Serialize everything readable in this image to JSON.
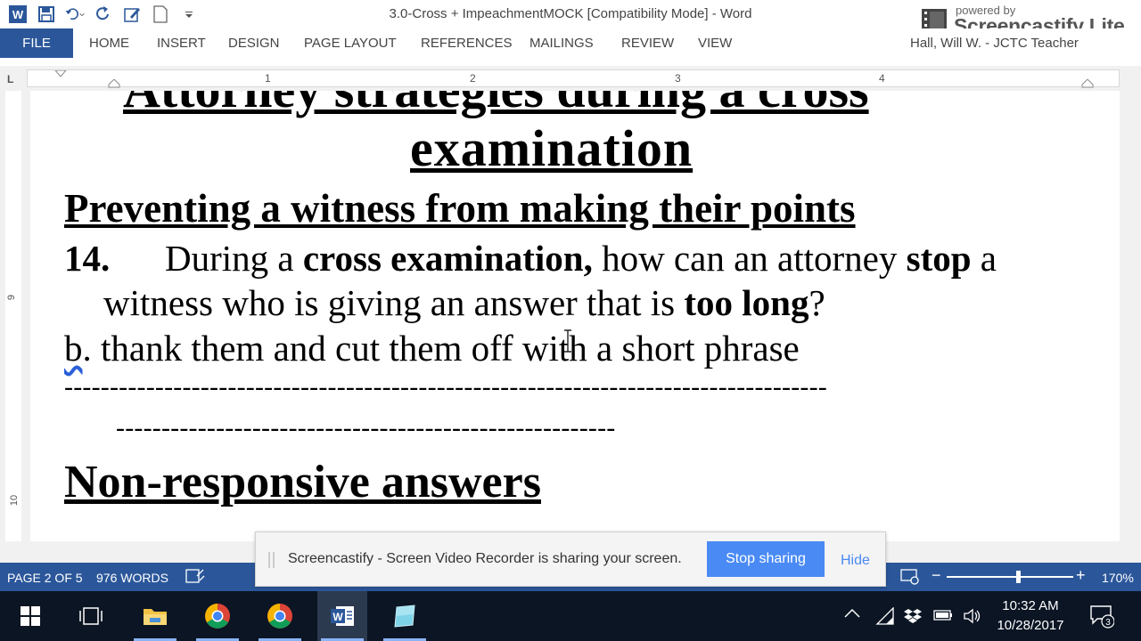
{
  "window": {
    "title": "3.0-Cross + ImpeachmentMOCK [Compatibility Mode] - Word"
  },
  "watermark": {
    "powered": "powered by",
    "name": "Screencastify Lite"
  },
  "ribbon": {
    "file": "FILE",
    "tabs": [
      "HOME",
      "INSERT",
      "DESIGN",
      "PAGE LAYOUT",
      "REFERENCES",
      "MAILINGS",
      "REVIEW",
      "VIEW"
    ],
    "user": "Hall, Will W. - JCTC Teacher"
  },
  "ruler": {
    "numbers": [
      "1",
      "2",
      "3",
      "4"
    ],
    "vertical_numbers": [
      "9",
      "10"
    ]
  },
  "document": {
    "heading_top": "Attorney strategies during a cross",
    "heading_exam": "examination",
    "subheading": "Preventing a witness from making their points",
    "question": {
      "number": "14.",
      "part1": "During a ",
      "bold1": "cross examination,",
      "part2": " how can an attorney ",
      "bold2": "stop",
      "part3": " a",
      "line2_part1": "witness who is giving an answer that is ",
      "line2_bold": "too long",
      "line2_end": "?"
    },
    "answer": {
      "letter": "b",
      "text": ". thank them and cut them off with a short phrase"
    },
    "dashes1": "------------------------------------------------------------------------------------",
    "dashes2": "-------------------------------------------------------",
    "heading_non": "Non-responsive answers"
  },
  "status": {
    "page": "PAGE 2 OF 5",
    "words": "976 WORDS",
    "zoom": "170%"
  },
  "sharebar": {
    "message": "Screencastify - Screen Video Recorder is sharing your screen.",
    "stop": "Stop sharing",
    "hide": "Hide"
  },
  "taskbar": {
    "time": "10:32 AM",
    "date": "10/28/2017",
    "notification_count": "3"
  },
  "colors": {
    "word_blue": "#2b579a",
    "taskbar": "#0b1523",
    "share_button": "#4a8af4"
  }
}
